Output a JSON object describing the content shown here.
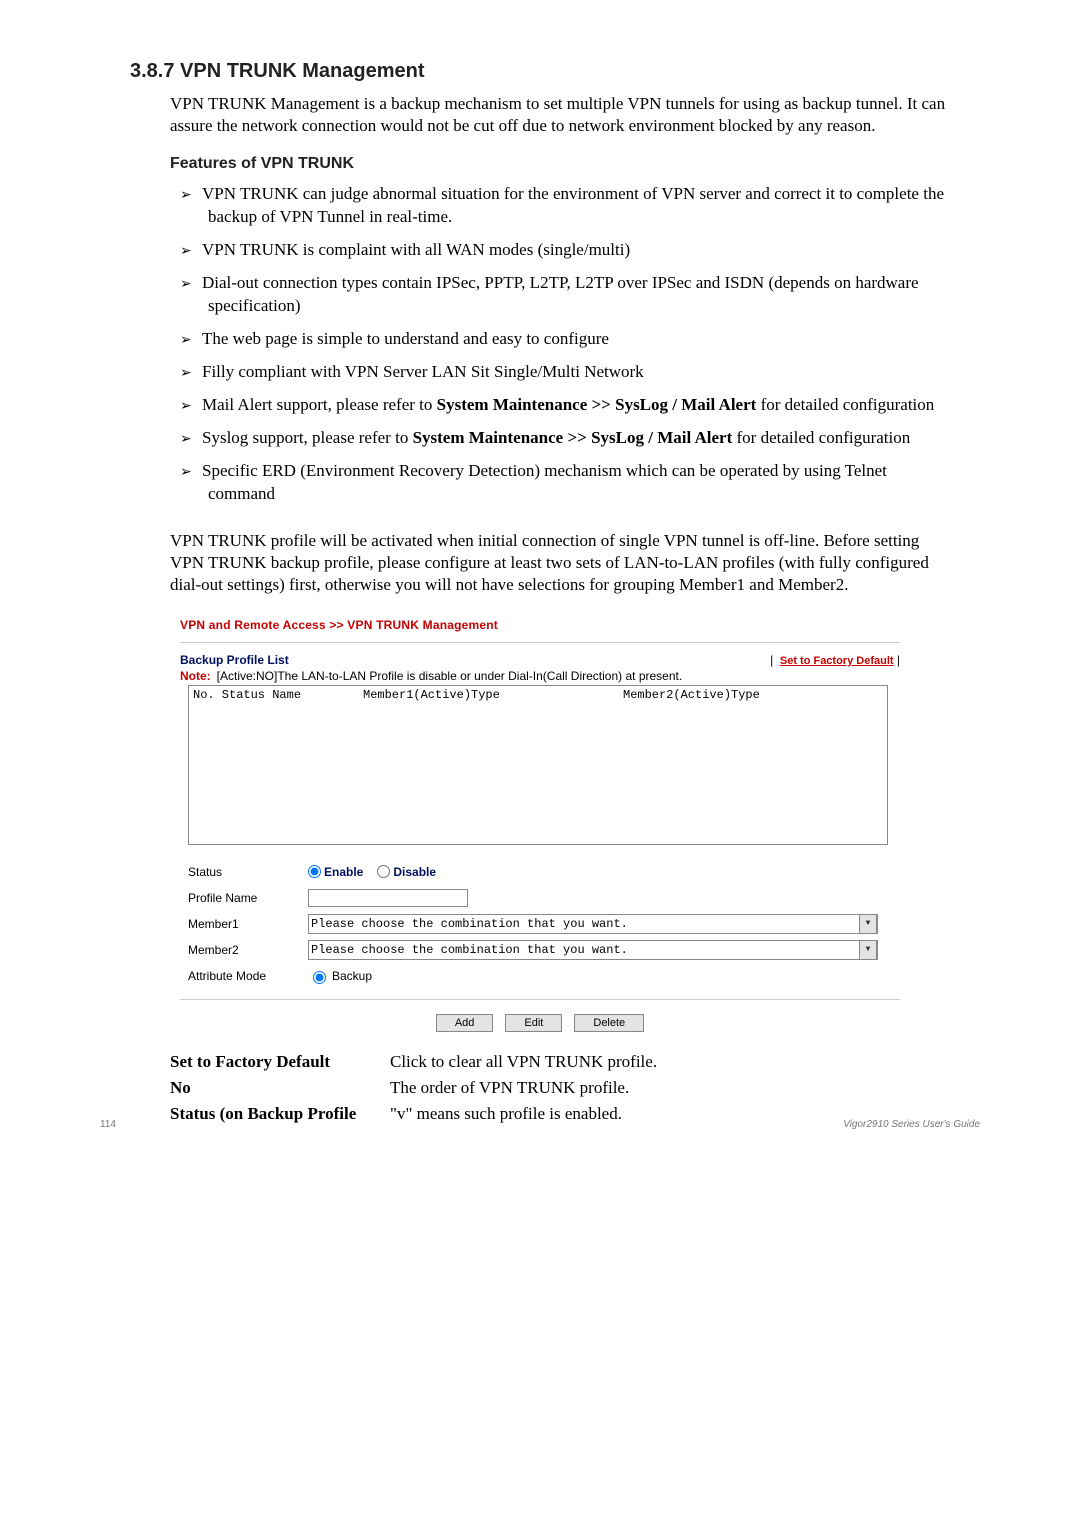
{
  "heading": "3.8.7 VPN TRUNK Management",
  "intro": "VPN TRUNK Management is a backup mechanism to set multiple VPN tunnels for using as backup tunnel. It can assure the network connection would not be cut off due to network environment blocked by any reason.",
  "subheading": "Features of VPN TRUNK",
  "features": [
    {
      "pre": "VPN TRUNK can judge abnormal situation for the environment of VPN server and correct it to complete the backup of VPN Tunnel in real-time.",
      "bold": "",
      "post": ""
    },
    {
      "pre": "VPN TRUNK is complaint with all WAN modes (single/multi)",
      "bold": "",
      "post": ""
    },
    {
      "pre": "Dial-out connection types contain IPSec, PPTP, L2TP, L2TP over IPSec and ISDN (depends on hardware specification)",
      "bold": "",
      "post": ""
    },
    {
      "pre": "The web page is simple to understand and easy to configure",
      "bold": "",
      "post": ""
    },
    {
      "pre": "Filly compliant with VPN Server LAN Sit Single/Multi Network",
      "bold": "",
      "post": ""
    },
    {
      "pre": "Mail Alert support, please refer to ",
      "bold": "System Maintenance >> SysLog / Mail Alert",
      "post": " for detailed configuration"
    },
    {
      "pre": "Syslog support, please refer to ",
      "bold": "System Maintenance >> SysLog / Mail Alert",
      "post": " for detailed configuration"
    },
    {
      "pre": "Specific ERD (Environment Recovery Detection) mechanism which can be operated by using Telnet command",
      "bold": "",
      "post": ""
    }
  ],
  "post_features_para": "VPN TRUNK profile will be activated when initial connection of single VPN tunnel is off-line. Before setting VPN TRUNK backup profile, please configure at least two sets of LAN-to-LAN profiles (with fully configured dial-out settings) first, otherwise you will not have selections for grouping Member1 and Member2.",
  "screenshot": {
    "breadcrumb": "VPN and Remote Access >> VPN TRUNK Management",
    "table_title": "Backup Profile List",
    "reset_link": "Set to Factory Default",
    "note_label": "Note:",
    "note_text": "[Active:NO]The LAN-to-LAN Profile is disable or under Dial-In(Call Direction) at present.",
    "list_cols": {
      "c1": "No. Status Name",
      "c2": "Member1(Active)Type",
      "c3": "Member2(Active)Type"
    },
    "form": {
      "status_label": "Status",
      "enable_label": "Enable",
      "disable_label": "Disable",
      "profile_name_label": "Profile Name",
      "member1_label": "Member1",
      "member2_label": "Member2",
      "attrmode_label": "Attribute Mode",
      "backup_label": "Backup",
      "dd_placeholder": "Please choose the combination that you want."
    },
    "buttons": {
      "add": "Add",
      "edit": "Edit",
      "delete": "Delete"
    }
  },
  "defs": [
    {
      "term": "Set to Factory Default",
      "desc": "Click to clear all VPN TRUNK profile."
    },
    {
      "term": "No",
      "desc": "The order of VPN TRUNK profile."
    },
    {
      "term": "Status (on Backup Profile",
      "desc": "\"v\" means such profile is enabled."
    }
  ],
  "footer": {
    "page_no": "114",
    "guide": "Vigor2910  Series  User's Guide"
  }
}
